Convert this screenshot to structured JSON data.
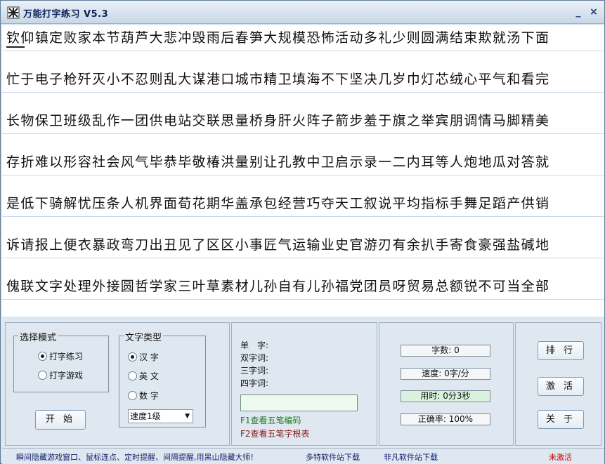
{
  "window": {
    "title": "万能打字练习 V5.3",
    "minimize_glyph": "_",
    "close_glyph": "×"
  },
  "practice_text": {
    "rows": [
      "钦仰镇定败家本节葫芦大悲冲毁雨后春笋大规模恐怖活动多礼少则圆满结束欺就汤下面",
      "忙于电子枪歼灭小不忍则乱大谋港口城市精卫填海不下坚决几岁巾灯芯绒心平气和看完",
      "长物保卫班级乱作一团供电站交联思量桥身肝火阵子箭步羞于旗之举宾朋调情马脚精美",
      "存折难以形容社会风气毕恭毕敬椿洪量别让孔教中卫启示录一二内耳等人炮地瓜对答就",
      "是低下骑解忧压条人机界面荀花期华盖承包经营巧夺天工叙说平均指标手舞足蹈产供销",
      "诉请报上便衣暴政弯刀出丑见了区区小事匠气运输业史官游刃有余扒手寄食豪强盐碱地",
      "傀联文字处理外接圆哲学家三叶草素材儿孙自有儿孙福党团员呀贸易总额锐不可当全部"
    ]
  },
  "mode_group": {
    "label": "选择模式",
    "options": [
      "打字练习",
      "打字游戏"
    ],
    "selected": 0
  },
  "text_type_group": {
    "label": "文字类型",
    "options": [
      "汉 字",
      "英 文",
      "数 字"
    ],
    "selected": 0,
    "speed_select": {
      "value": "速度1级"
    }
  },
  "start_button": "开 始",
  "wubi_info": {
    "single": "单　字:",
    "double": "双字词:",
    "triple": "三字词:",
    "quad": "四字词:",
    "hint_f1": "F1查看五笔编码",
    "hint_f2": "F2查看五笔字根表"
  },
  "stats": {
    "count": "字数: 0",
    "speed": "速度: 0字/分",
    "time": "用时: 0分3秒",
    "accuracy": "正确率: 100%"
  },
  "buttons": {
    "ranking": "排 行",
    "activate": "激 活",
    "about": "关 于"
  },
  "status_bar": {
    "ad": "瞬间隐藏游戏窗口、鼠标连点、定时提醒、间隔提醒,用黑山隐藏大师!",
    "link1": "多特软件站下载",
    "link2": "非凡软件站下载",
    "activation": "未激活"
  },
  "colors": {
    "hint_f1": "#1f7a1f",
    "hint_f2": "#8b1a1a",
    "status_link": "#0b1f6b",
    "unactivated": "#cc0000"
  }
}
